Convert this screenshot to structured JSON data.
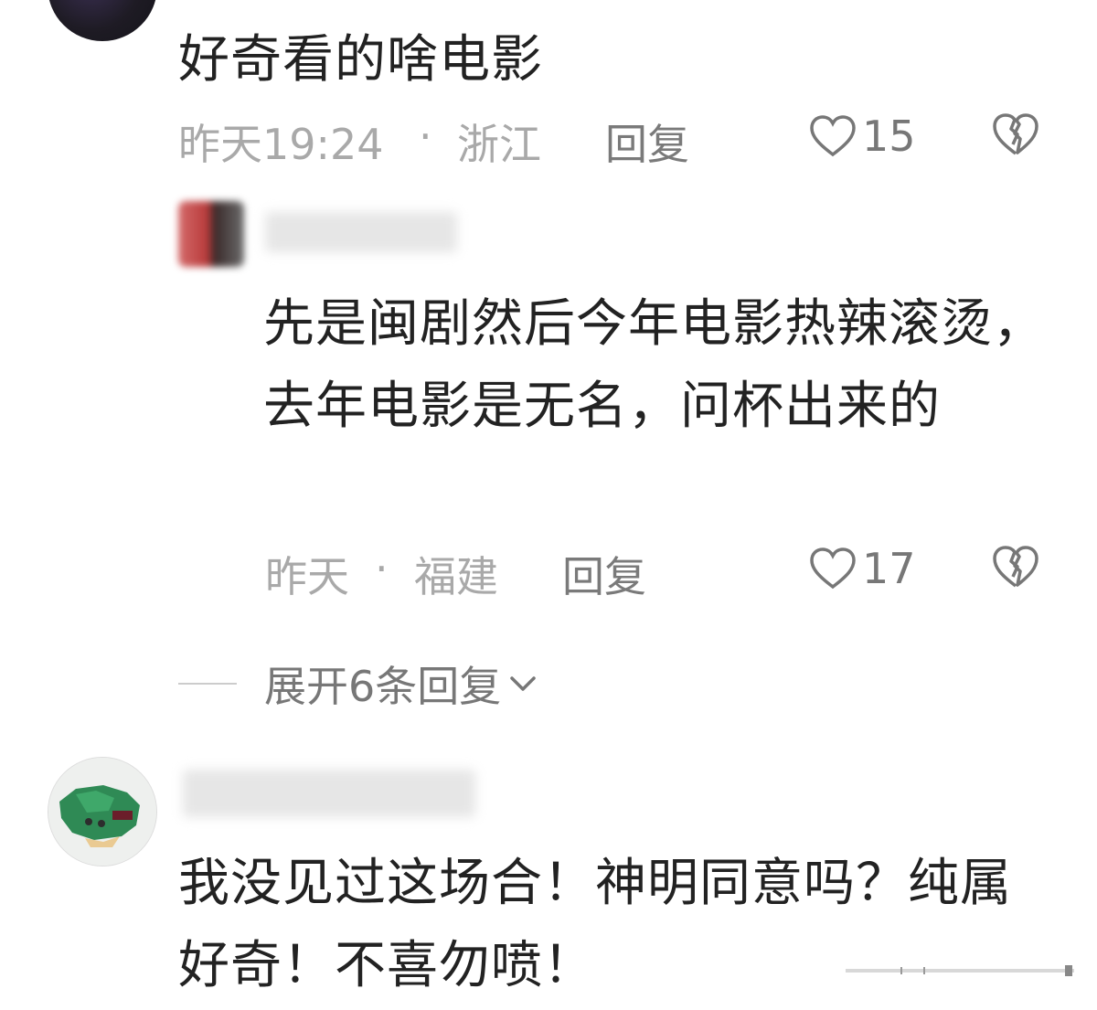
{
  "comments": [
    {
      "text": "好奇看的啥电影",
      "time": "昨天19:24",
      "sep": "·",
      "location": "浙江",
      "reply_label": "回复",
      "likes": "15"
    },
    {
      "text": "先是闽剧然后今年电影热辣滚烫，去年电影是无名，问杯出来的",
      "time": "昨天",
      "sep": "·",
      "location": "福建",
      "reply_label": "回复",
      "likes": "17"
    },
    {
      "text": "我没见过这场合！神明同意吗？纯属好奇！不喜勿喷！"
    }
  ],
  "expand_replies_label": "展开6条回复",
  "expand_icon": "chevron-down-icon",
  "icons": {
    "like": "heart-outline-icon",
    "dislike": "broken-heart-icon"
  },
  "colors": {
    "primary_text": "#222222",
    "meta_text": "#a9a9a9",
    "action_text": "#7a7a7a"
  }
}
